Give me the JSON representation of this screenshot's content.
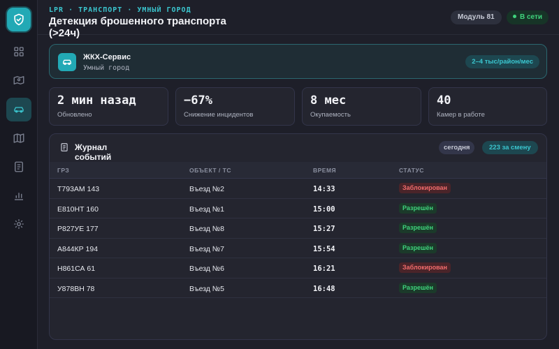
{
  "header": {
    "eyebrow": "LPR · ТРАНСПОРТ · УМНЫЙ ГОРОД",
    "title": "Детекция брошенного транспорта (>24ч)",
    "module_badge": "Модуль 81",
    "online_badge": "В сети"
  },
  "sidebar": {
    "items": [
      {
        "icon": "dashboard-icon",
        "active": false
      },
      {
        "icon": "map-pin-icon",
        "active": false
      },
      {
        "icon": "car-icon",
        "active": true
      },
      {
        "icon": "map-icon",
        "active": false
      },
      {
        "icon": "document-icon",
        "active": false
      },
      {
        "icon": "bar-chart-icon",
        "active": false
      },
      {
        "icon": "gear-icon",
        "active": false
      }
    ]
  },
  "service": {
    "name": "ЖКХ-Сервис",
    "subtitle": "Умный город",
    "price": "2–4 тыс/район/мес"
  },
  "stats": [
    {
      "value": "2 мин назад",
      "label": "Обновлено"
    },
    {
      "value": "−67%",
      "label": "Снижение инцидентов"
    },
    {
      "value": "8 мес",
      "label": "Окупаемость"
    },
    {
      "value": "40",
      "label": "Камер в работе"
    }
  ],
  "log": {
    "title": "Журнал событий",
    "period_badge": "сегодня",
    "count_badge": "223 за смену",
    "columns": [
      "ГРЗ",
      "ОБЪЕКТ / ТС",
      "ВРЕМЯ",
      "СТАТУС"
    ],
    "rows": [
      {
        "plate": "Т793АМ 143",
        "object": "Въезд №2",
        "time": "14:33",
        "status": "Заблокирован",
        "state": "blocked"
      },
      {
        "plate": "Е810НТ 160",
        "object": "Въезд №1",
        "time": "15:00",
        "status": "Разрешён",
        "state": "allowed"
      },
      {
        "plate": "Р827УЕ 177",
        "object": "Въезд №8",
        "time": "15:27",
        "status": "Разрешён",
        "state": "allowed"
      },
      {
        "plate": "А844КР 194",
        "object": "Въезд №7",
        "time": "15:54",
        "status": "Разрешён",
        "state": "allowed"
      },
      {
        "plate": "Н861СА 61",
        "object": "Въезд №6",
        "time": "16:21",
        "status": "Заблокирован",
        "state": "blocked"
      },
      {
        "plate": "У878ВН 78",
        "object": "Въезд №5",
        "time": "16:48",
        "status": "Разрешён",
        "state": "allowed"
      }
    ]
  },
  "colors": {
    "accent": "#22a9b5",
    "background": "#1e1f29",
    "allowed": "#3fd37c",
    "blocked": "#f26c6c"
  }
}
